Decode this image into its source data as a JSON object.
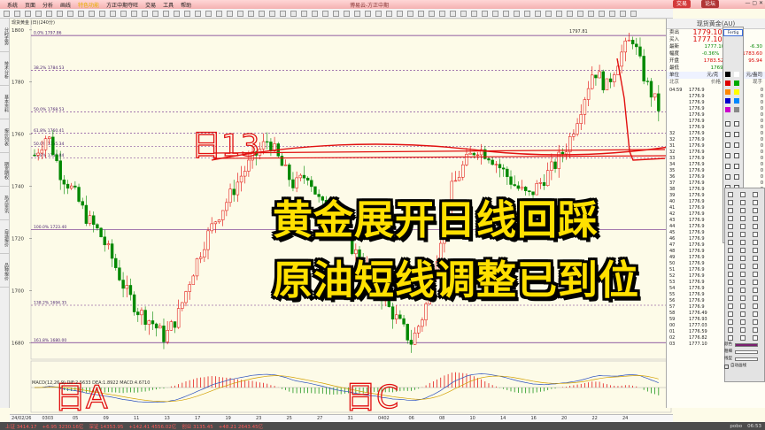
{
  "menu": {
    "items": [
      "系统",
      "页面",
      "分析",
      "画线",
      "特色功能",
      "方正中期夺旺",
      "交易",
      "工具",
      "帮助"
    ],
    "active_index": 4,
    "app_title": "博易云-方正中期",
    "trade_label": "交易",
    "forum_label": "论坛"
  },
  "side_tabs": [
    "分时走势",
    "技术分析",
    "基本资料",
    "报价列表",
    "期货期权",
    "热点资讯",
    "自选报价",
    "品种报价"
  ],
  "chart": {
    "label": "现货黄金 (日)(240分)",
    "macd_label": "MACD(12,26,9) DIF:2.5633 DEA:1.8922 MACD:4.6710",
    "y_ticks": [
      "1800",
      "1780",
      "1760",
      "1740",
      "1720",
      "1700",
      "1680"
    ],
    "fib_labels": [
      "0.0% 1797.86",
      "38.2% 1784.53",
      "50.0% 1768.53",
      "61.8% 1760.41",
      "50.0% 1755.34",
      "61.8% 1750.84",
      "100.0% 1723.40",
      "138.2% 1694.35",
      "161.8% 1680.00"
    ],
    "high_label": "1797.81",
    "annotations": [
      "日13",
      "日A",
      "日C"
    ],
    "dates": [
      "24/02/26",
      "0303",
      "05",
      "09",
      "11",
      "13",
      "17",
      "19",
      "23",
      "25",
      "27",
      "31",
      "0402",
      "06",
      "08",
      "10",
      "14",
      "16",
      "20",
      "22",
      "24"
    ]
  },
  "caption": {
    "line1": "黄金展开日线回踩",
    "line2": "原油短线调整已到位"
  },
  "quote": {
    "title": "现货黄金(AU)",
    "sell_label": "卖出",
    "sell_value": "1779.10",
    "buy_label": "买入",
    "buy_value": "1777.10",
    "latest_label": "最新",
    "latest_value": "1777.10",
    "change_value": "-6.30",
    "range_label": "幅度",
    "range_value": "-0.36%",
    "high_value": "1783.60",
    "open_label": "开盘",
    "open_value": "1783.52",
    "close_value": "95.94",
    "low_label": "最低",
    "low_value": "1769.60",
    "unit_label": "单位",
    "unit_value": "元/克",
    "unit_extra": "元/盎司",
    "col_time": "北京",
    "col_price": "价格",
    "col_vol": "现手",
    "ticks": [
      [
        "04:59",
        "1776.9",
        "0"
      ],
      [
        "",
        "1776.9",
        "0"
      ],
      [
        "",
        "1776.9",
        "0"
      ],
      [
        "",
        "1776.9",
        "0"
      ],
      [
        "",
        "1776.9",
        "0"
      ],
      [
        "",
        "1776.9",
        "0"
      ],
      [
        "",
        "1776.9",
        "0"
      ],
      [
        "32",
        "1776.9",
        "0"
      ],
      [
        "32",
        "1776.9",
        "0"
      ],
      [
        "31",
        "1776.9",
        "0"
      ],
      [
        "32",
        "1776.9",
        "0"
      ],
      [
        "33",
        "1776.9",
        "0"
      ],
      [
        "34",
        "1776.9",
        "0"
      ],
      [
        "35",
        "1776.9",
        "0"
      ],
      [
        "36",
        "1776.9",
        "0"
      ],
      [
        "37",
        "1776.9",
        "0"
      ],
      [
        "38",
        "1776.9",
        "0"
      ],
      [
        "39",
        "1776.9",
        "0"
      ],
      [
        "40",
        "1776.9",
        "0"
      ],
      [
        "41",
        "1776.9",
        "0"
      ],
      [
        "42",
        "1776.9",
        "0"
      ],
      [
        "43",
        "1776.9",
        "0"
      ],
      [
        "44",
        "1776.9",
        "0"
      ],
      [
        "45",
        "1776.9",
        "0"
      ],
      [
        "46",
        "1776.9",
        "0"
      ],
      [
        "47",
        "1776.9",
        "0"
      ],
      [
        "48",
        "1776.9",
        "0"
      ],
      [
        "49",
        "1776.9",
        "0"
      ],
      [
        "50",
        "1776.9",
        "0"
      ],
      [
        "51",
        "1776.9",
        "0"
      ],
      [
        "52",
        "1776.9",
        "0"
      ],
      [
        "53",
        "1776.9",
        "0"
      ],
      [
        "54",
        "1776.9",
        "0"
      ],
      [
        "55",
        "1776.9",
        "0"
      ],
      [
        "56",
        "1776.9",
        "0"
      ],
      [
        "57",
        "1776.9",
        "0"
      ],
      [
        "58",
        "1776.49",
        "0"
      ],
      [
        "59",
        "1776.93",
        "0"
      ],
      [
        "00",
        "1777.03",
        "0"
      ],
      [
        "01",
        "1776.59",
        "0"
      ],
      [
        "02",
        "1776.82",
        "0"
      ],
      [
        "03",
        "1777.10",
        "0"
      ]
    ]
  },
  "toolbox": {
    "title": "Fertig"
  },
  "props": {
    "color_label": "颜色",
    "width_label": "粗细",
    "style_label": "线型",
    "auto_label": "自动画线"
  },
  "status": {
    "items": [
      {
        "text": "上证 3414.17",
        "dir": "up"
      },
      {
        "text": "+6.95 3230.16亿",
        "dir": "up"
      },
      {
        "text": "深证 14353.95",
        "dir": "up"
      },
      {
        "text": "+142.41 4556.02亿",
        "dir": "up"
      },
      {
        "text": "创业 3135.45",
        "dir": "up"
      },
      {
        "text": "+48.21 2643.45亿",
        "dir": "up"
      }
    ],
    "brand": "pobo",
    "clock": "06:53"
  },
  "colors": {
    "up": "#e00000",
    "down": "#008800",
    "fib": "#6e2a8a",
    "draw": "#e11010",
    "caption": "#ffe000"
  }
}
